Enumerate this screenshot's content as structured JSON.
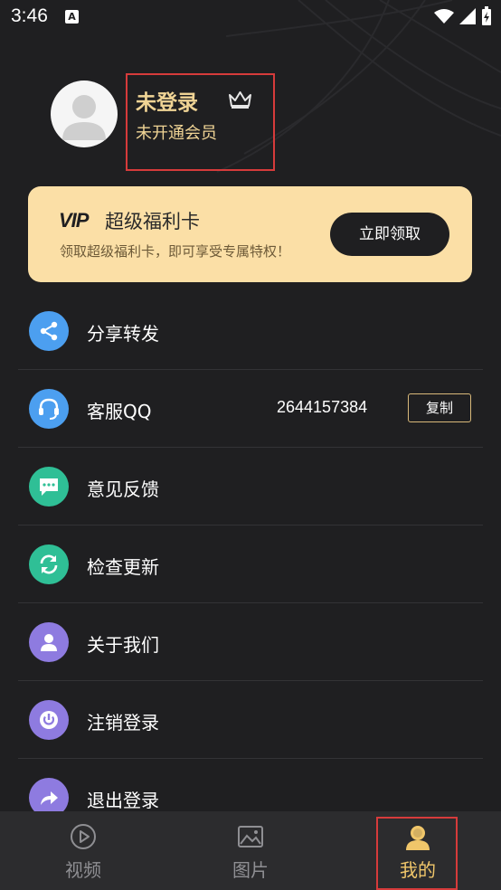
{
  "status_bar": {
    "time": "3:46",
    "notification_badge": "A"
  },
  "profile": {
    "login_status": "未登录",
    "member_status": "未开通会员",
    "crown_icon": "crown-icon"
  },
  "vip_card": {
    "logo": "VIP",
    "title": "超级福利卡",
    "description": "领取超级福利卡，即可享受专属特权！",
    "button_label": "立即领取",
    "background_color": "#fbdfa6"
  },
  "menu": {
    "items": [
      {
        "label": "分享转发",
        "icon": "share-icon",
        "color": "#4c9ff0"
      },
      {
        "label": "客服QQ",
        "icon": "headset-icon",
        "color": "#4c9ff0",
        "value": "2644157384",
        "action_label": "复制"
      },
      {
        "label": "意见反馈",
        "icon": "chat-bubble-icon",
        "color": "#2fbf96"
      },
      {
        "label": "检查更新",
        "icon": "refresh-icon",
        "color": "#2fbf96"
      },
      {
        "label": "关于我们",
        "icon": "user-icon",
        "color": "#8e7be0"
      },
      {
        "label": "注销登录",
        "icon": "power-icon",
        "color": "#8e7be0"
      },
      {
        "label": "退出登录",
        "icon": "exit-arrow-icon",
        "color": "#8e7be0"
      }
    ]
  },
  "tabs": [
    {
      "label": "视频",
      "icon": "play-circle-icon",
      "active": false
    },
    {
      "label": "图片",
      "icon": "image-icon",
      "active": false
    },
    {
      "label": "我的",
      "icon": "profile-icon",
      "active": true
    }
  ],
  "colors": {
    "accent": "#f0c66a",
    "background": "#1f1f21",
    "tab_bar": "#2c2c2e"
  }
}
